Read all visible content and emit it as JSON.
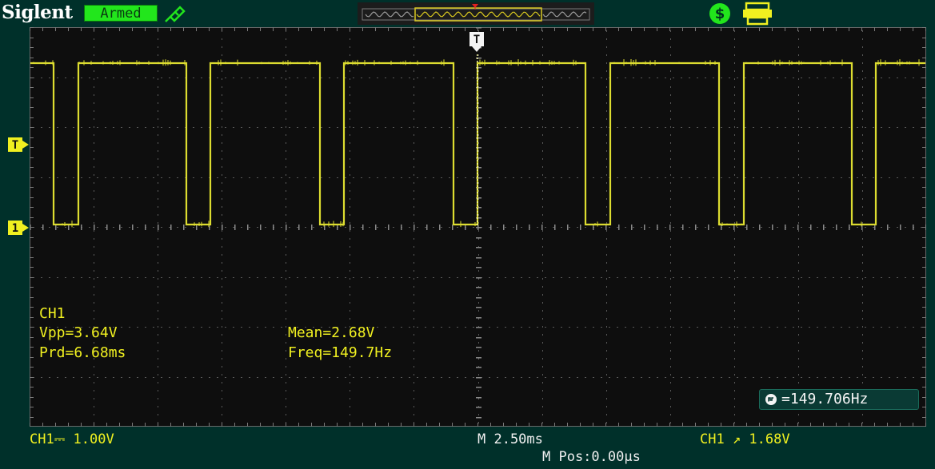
{
  "header": {
    "brand": "Siglent",
    "acquire_status": "Armed",
    "probe_icon": "probe-icon",
    "timebase_icon": "timebase-overview-icon",
    "power_icon": "dollar-icon",
    "usb_icon": "printer-icon"
  },
  "markers": {
    "trigger_top": "T",
    "trigger_level": "T",
    "channel1": "1"
  },
  "measurements": {
    "channel": "CH1",
    "vpp": "Vpp=3.64V",
    "mean": "Mean=2.68V",
    "period": "Prd=6.68ms",
    "frequency": "Freq=149.7Hz"
  },
  "counter": {
    "icon": "frequency-counter-icon",
    "value": "=149.706Hz"
  },
  "status_bar": {
    "channel_scale": "CH1⎓ 1.00V",
    "timebase": "M 2.50ms",
    "position": "M Pos:0.00μs",
    "trigger": "CH1 ↗ 1.68V"
  },
  "colors": {
    "trace": "#dcdc30",
    "text": "#f0f020",
    "armed_bg": "#22e61c",
    "background": "#0e0e0e"
  },
  "waveform": {
    "high_level_v": 3.64,
    "low_level_v": 0.0,
    "period_ms": 6.68,
    "duty_high_fraction": 0.82
  }
}
